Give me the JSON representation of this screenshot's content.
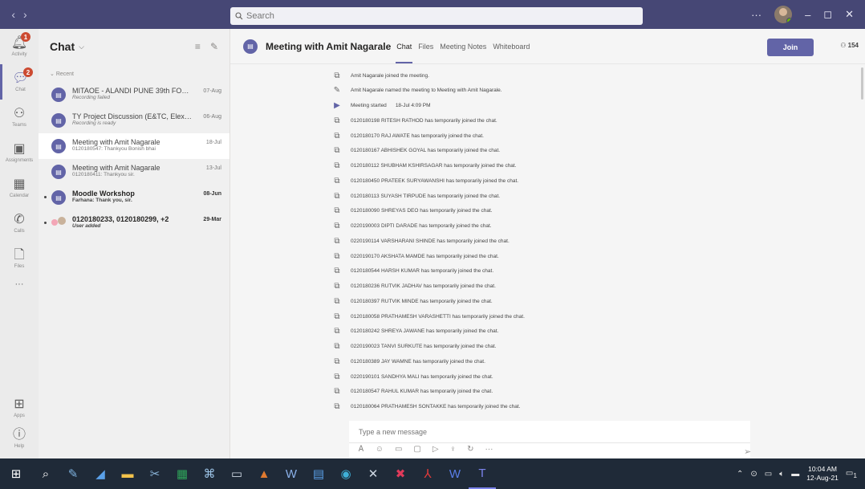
{
  "titlebar": {
    "search_placeholder": "Search",
    "nav_back": "‹",
    "nav_forward": "›",
    "more": "···",
    "minimize": "–",
    "maximize": "◻",
    "close": "✕"
  },
  "rail": {
    "items": [
      {
        "label": "Activity",
        "icon": "bell-icon",
        "badge": "1"
      },
      {
        "label": "Chat",
        "icon": "chat-icon",
        "badge": "2"
      },
      {
        "label": "Teams",
        "icon": "teams-icon"
      },
      {
        "label": "Assignments",
        "icon": "backpack-icon"
      },
      {
        "label": "Calendar",
        "icon": "calendar-icon"
      },
      {
        "label": "Calls",
        "icon": "phone-icon"
      },
      {
        "label": "Files",
        "icon": "file-icon"
      },
      {
        "label": "···",
        "icon": "more-icon"
      },
      {
        "label": "Apps",
        "icon": "apps-icon"
      },
      {
        "label": "Help",
        "icon": "help-icon"
      }
    ]
  },
  "chat_list": {
    "title": "Chat",
    "section": "Recent",
    "items": [
      {
        "name": "MITAOE - ALANDI PUNE 39th FOUN...",
        "sub": "Recording failed",
        "date": "07-Aug"
      },
      {
        "name": "TY Project Discussion (E&TC, Elex Co...",
        "sub": "Recording is ready",
        "date": "06-Aug"
      },
      {
        "name": "Meeting with Amit Nagarale",
        "sub": "0120180547: Thankyou Bonish bhai",
        "date": "18-Jul"
      },
      {
        "name": "Meeting with Amit Nagarale",
        "sub": "0120180411: Thankyou sir.",
        "date": "13-Jul"
      },
      {
        "name": "Moodle Workshop",
        "sub": "Farhana: Thank you, sir.",
        "date": "08-Jun"
      },
      {
        "name": "0120180233, 0120180299, +2",
        "sub": "User added",
        "date": "29-Mar"
      }
    ]
  },
  "main": {
    "title": "Meeting with Amit Nagarale",
    "tabs": [
      "Chat",
      "Files",
      "Meeting Notes",
      "Whiteboard"
    ],
    "join_label": "Join",
    "participant_count": "154",
    "events": [
      {
        "icon": "join-icon",
        "text": "Amit Nagarale joined the meeting."
      },
      {
        "icon": "pencil-icon",
        "text": "Amit Nagarale named the meeting to Meeting with Amit Nagarale."
      },
      {
        "icon": "video-icon",
        "text": "Meeting started",
        "time": "18-Jul 4:09 PM"
      },
      {
        "icon": "join-icon",
        "text": "0120180198 RITESH RATHOD has temporarily joined the chat."
      },
      {
        "icon": "join-icon",
        "text": "0120180170 RAJ AWATE has temporarily joined the chat."
      },
      {
        "icon": "join-icon",
        "text": "0120180167 ABHISHEK GOYAL has temporarily joined the chat."
      },
      {
        "icon": "join-icon",
        "text": "0120180112 SHUBHAM KSHIRSAGAR has temporarily joined the chat."
      },
      {
        "icon": "join-icon",
        "text": "0120180450 PRATEEK SURYAWANSHI has temporarily joined the chat."
      },
      {
        "icon": "join-icon",
        "text": "0120180113 SUYASH TIRPUDE has temporarily joined the chat."
      },
      {
        "icon": "join-icon",
        "text": "0120180090 SHREYAS DEO has temporarily joined the chat."
      },
      {
        "icon": "join-icon",
        "text": "0220190003 DIPTI DARADE has temporarily joined the chat."
      },
      {
        "icon": "join-icon",
        "text": "0220190114 VARSHARANI SHINDE has temporarily joined the chat."
      },
      {
        "icon": "join-icon",
        "text": "0220190170 AKSHATA MAMDE has temporarily joined the chat."
      },
      {
        "icon": "join-icon",
        "text": "0120180544 HARSH KUMAR has temporarily joined the chat."
      },
      {
        "icon": "join-icon",
        "text": "0120180236 RUTVIK JADHAV has temporarily joined the chat."
      },
      {
        "icon": "join-icon",
        "text": "0120180397 RUTVIK MINDE has temporarily joined the chat."
      },
      {
        "icon": "join-icon",
        "text": "0120180058 PRATHAMESH VARASHETTI has temporarily joined the chat."
      },
      {
        "icon": "join-icon",
        "text": "0120180242 SHREYA JAWANE has temporarily joined the chat."
      },
      {
        "icon": "join-icon",
        "text": "0220190023 TANVI SURKUTE has temporarily joined the chat."
      },
      {
        "icon": "join-icon",
        "text": "0120180389 JAY WAMNE has temporarily joined the chat."
      },
      {
        "icon": "join-icon",
        "text": "0220190101 SANDHYA MALI has temporarily joined the chat."
      },
      {
        "icon": "join-icon",
        "text": "0120180547 RAHUL KUMAR has temporarily joined the chat."
      },
      {
        "icon": "join-icon",
        "text": "0120180064 PRATHAMESH SONTAKKE has temporarily joined the chat."
      }
    ],
    "composer_placeholder": "Type a new message"
  },
  "taskbar": {
    "time": "10:04 AM",
    "date": "12-Aug-21",
    "notification_count": "1"
  },
  "colors": {
    "titlebar": "#464775",
    "accent": "#6264a7",
    "badge": "#cc4a31",
    "taskbar": "#1f2a38"
  }
}
